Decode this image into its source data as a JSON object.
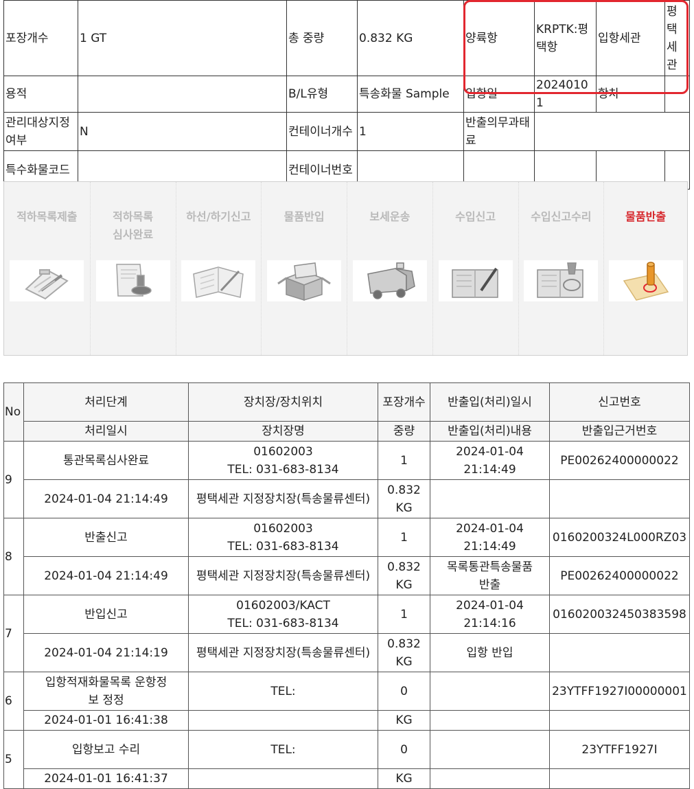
{
  "cargo_info": {
    "row1": {
      "pkg_count_label": "포장개수",
      "pkg_count_value": "1 GT",
      "gross_weight_label": "총 중량",
      "gross_weight_value": "0.832 KG",
      "unloading_port_label": "양륙항",
      "unloading_port_value": "KRPTK:평택항",
      "customs_label": "입항세관",
      "customs_value": "평택세관"
    },
    "row2": {
      "volume_label": "용적",
      "volume_value": "",
      "bl_type_label": "B/L유형",
      "bl_type_value": "특송화물 Sample",
      "arrival_date_label": "입항일",
      "arrival_date_value": "20240101",
      "voyage_label": "항차",
      "voyage_value": ""
    },
    "row3": {
      "managed_label": "관리대상지정여부",
      "managed_value": "N",
      "container_count_label": "컨테이너개수",
      "container_count_value": "1",
      "release_penalty_label": "반출의무과태료",
      "release_penalty_value": ""
    },
    "row4": {
      "special_code_label": "특수화물코드",
      "special_code_value": "",
      "container_no_label": "컨테이너번호",
      "container_no_value": ""
    }
  },
  "progress_steps": [
    {
      "label": "적하목록제출",
      "icon": "clipboard-pen-icon",
      "active": false
    },
    {
      "label": "적하목록\n심사완료",
      "icon": "document-stamp-icon",
      "active": false
    },
    {
      "label": "하선/하기신고",
      "icon": "open-book-icon",
      "active": false
    },
    {
      "label": "물품반입",
      "icon": "open-box-icon",
      "active": false
    },
    {
      "label": "보세운송",
      "icon": "truck-icon",
      "active": false
    },
    {
      "label": "수입신고",
      "icon": "book-pen-icon",
      "active": false
    },
    {
      "label": "수입신고수리",
      "icon": "book-stamp-icon",
      "active": false
    },
    {
      "label": "물품반출",
      "icon": "seal-stamp-icon",
      "active": true
    }
  ],
  "history": {
    "header": {
      "no": "No",
      "stage": "처리단계",
      "location": "장치장/장치위치",
      "pkg": "포장개수",
      "inout_datetime": "반출입(처리)일시",
      "report_no": "신고번호",
      "process_datetime": "처리일시",
      "location_name": "장치장명",
      "weight": "중량",
      "inout_content": "반출입(처리)내용",
      "basis_no": "반출입근거번호"
    },
    "rows": [
      {
        "no": "9",
        "stage": "통관목록심사완료",
        "location": "01602003\nTEL: 031-683-8134",
        "pkg": "1",
        "inout_datetime": "2024-01-04\n21:14:49",
        "report_no": "PE00262400000022",
        "process_datetime": "2024-01-04 21:14:49",
        "location_name": "평택세관 지정장치장(특송물류센터)",
        "weight": "0.832\nKG",
        "inout_content": "",
        "basis_no": ""
      },
      {
        "no": "8",
        "stage": "반출신고",
        "location": "01602003\nTEL: 031-683-8134",
        "pkg": "1",
        "inout_datetime": "2024-01-04\n21:14:49",
        "report_no": "0160200324L000RZ03",
        "process_datetime": "2024-01-04 21:14:49",
        "location_name": "평택세관 지정장치장(특송물류센터)",
        "weight": "0.832\nKG",
        "inout_content": "목록통관특송물품\n반출",
        "basis_no": "PE00262400000022"
      },
      {
        "no": "7",
        "stage": "반입신고",
        "location": "01602003/KACT\nTEL: 031-683-8134",
        "pkg": "1",
        "inout_datetime": "2024-01-04\n21:14:16",
        "report_no": "016020032450383598",
        "process_datetime": "2024-01-04 21:14:19",
        "location_name": "평택세관 지정장치장(특송물류센터)",
        "weight": "0.832\nKG",
        "inout_content": "입항 반입",
        "basis_no": ""
      },
      {
        "no": "6",
        "stage": "입항적재화물목록 운항정\n보 정정",
        "location": "TEL:",
        "pkg": "0",
        "inout_datetime": "",
        "report_no": "23YTFF1927I00000001",
        "process_datetime": "2024-01-01 16:41:38",
        "location_name": "",
        "weight": "KG",
        "inout_content": "",
        "basis_no": ""
      },
      {
        "no": "5",
        "stage": "입항보고 수리",
        "location": "TEL:",
        "pkg": "0",
        "inout_datetime": "",
        "report_no": "23YTFF1927I",
        "process_datetime": "2024-01-01 16:41:37",
        "location_name": "",
        "weight": "KG",
        "inout_content": "",
        "basis_no": ""
      }
    ]
  },
  "colors": {
    "highlight": "#e2272f",
    "active_step": "#d6262b",
    "inactive_step": "#b9b9b9"
  }
}
